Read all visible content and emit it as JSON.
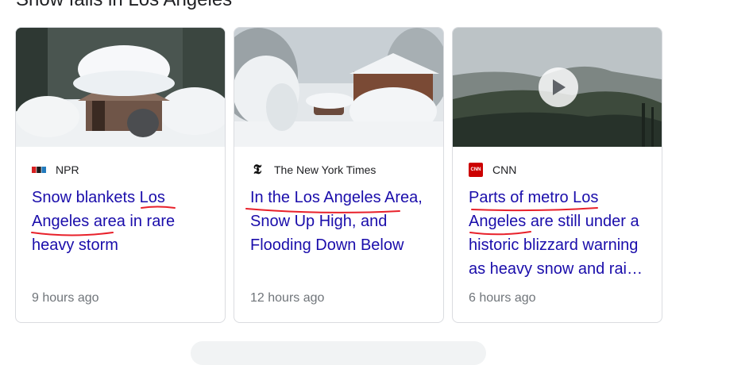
{
  "section": {
    "title": "Snow falls in Los Angeles"
  },
  "cards": [
    {
      "source": "NPR",
      "source_icon": "npr-logo-icon",
      "headline": "Snow blankets Los Angeles area in rare heavy storm",
      "time": "9 hours ago"
    },
    {
      "source": "The New York Times",
      "source_icon": "nyt-logo-icon",
      "headline": "In the Los Angeles Area, Snow Up High, and Flooding Down Below",
      "time": "12 hours ago"
    },
    {
      "source": "CNN",
      "source_icon": "cnn-logo-icon",
      "headline": "Parts of metro Los Angeles are still under a historic blizzard warning as heavy snow and rai…",
      "time": "6 hours ago",
      "has_video": true
    }
  ],
  "colors": {
    "headline": "#1a0dab",
    "meta": "#70757a",
    "annotation": "#e8212b",
    "border": "#dadce0"
  }
}
